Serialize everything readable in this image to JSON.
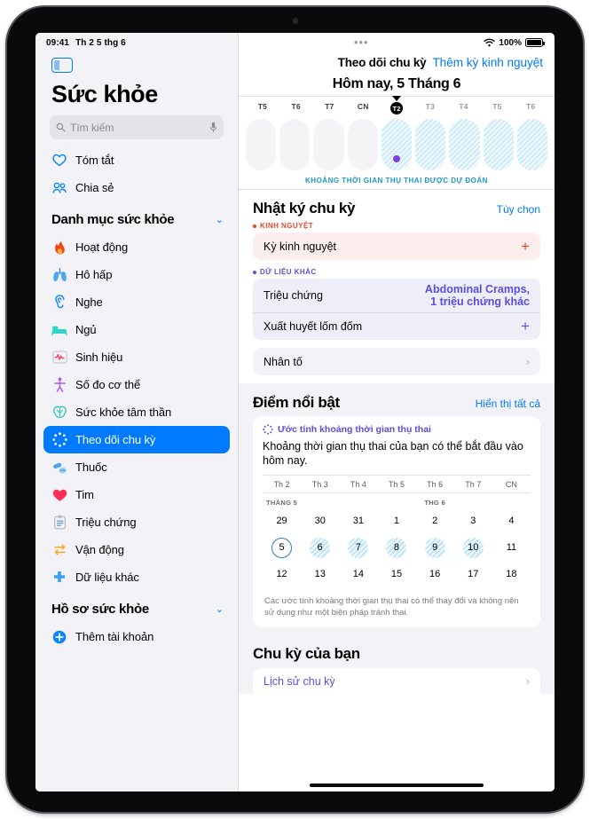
{
  "status": {
    "time": "09:41",
    "date": "Th 2 5 thg 6",
    "battery_pct": "100%",
    "wifi_icon": "wifi-icon"
  },
  "sidebar": {
    "app_title": "Sức khỏe",
    "search": {
      "placeholder": "Tìm kiếm",
      "search_icon": "search-icon",
      "mic_icon": "microphone-icon"
    },
    "toggle_icon": "sidebar-toggle-icon",
    "top_items": [
      {
        "label": "Tóm tắt",
        "icon": "heart-outline-icon"
      },
      {
        "label": "Chia sẻ",
        "icon": "people-icon"
      }
    ],
    "category_header": {
      "label": "Danh mục sức khỏe",
      "chevron": "chevron-down-icon"
    },
    "categories": [
      {
        "label": "Hoạt động",
        "icon": "flame-icon",
        "selected": false
      },
      {
        "label": "Hô hấp",
        "icon": "lungs-icon",
        "selected": false
      },
      {
        "label": "Nghe",
        "icon": "ear-icon",
        "selected": false
      },
      {
        "label": "Ngủ",
        "icon": "bed-icon",
        "selected": false
      },
      {
        "label": "Sinh hiệu",
        "icon": "vitals-icon",
        "selected": false
      },
      {
        "label": "Số đo cơ thể",
        "icon": "body-icon",
        "selected": false
      },
      {
        "label": "Sức khỏe tâm thần",
        "icon": "brain-icon",
        "selected": false
      },
      {
        "label": "Theo dõi chu kỳ",
        "icon": "cycle-icon",
        "selected": true
      },
      {
        "label": "Thuốc",
        "icon": "pills-icon",
        "selected": false
      },
      {
        "label": "Tim",
        "icon": "heart-filled-icon",
        "selected": false
      },
      {
        "label": "Triệu chứng",
        "icon": "clipboard-icon",
        "selected": false
      },
      {
        "label": "Vận động",
        "icon": "mobility-icon",
        "selected": false
      },
      {
        "label": "Dữ liệu khác",
        "icon": "plus-cross-icon",
        "selected": false
      }
    ],
    "profile_header": {
      "label": "Hồ sơ sức khỏe",
      "chevron": "chevron-down-icon"
    },
    "profile_items": [
      {
        "label": "Thêm tài khoản",
        "icon": "plus-circle-icon"
      }
    ]
  },
  "main": {
    "multitask_icon": "multitask-dots-icon",
    "nav_title": "Theo dõi chu kỳ",
    "nav_action": "Thêm kỳ kinh nguyệt",
    "today_title": "Hôm nay, 5 Tháng 6",
    "week_strip": {
      "days": [
        {
          "label": "T5",
          "state": "past",
          "fertile": false,
          "today": false
        },
        {
          "label": "T6",
          "state": "past",
          "fertile": false,
          "today": false
        },
        {
          "label": "T7",
          "state": "past",
          "fertile": false,
          "today": false
        },
        {
          "label": "CN",
          "state": "past",
          "fertile": false,
          "today": false
        },
        {
          "label": "T2",
          "state": "today",
          "fertile": true,
          "today": true
        },
        {
          "label": "T3",
          "state": "future",
          "fertile": true,
          "today": false
        },
        {
          "label": "T4",
          "state": "future",
          "fertile": true,
          "today": false
        },
        {
          "label": "T5",
          "state": "future",
          "fertile": true,
          "today": false
        },
        {
          "label": "T6",
          "state": "future",
          "fertile": true,
          "today": false
        }
      ],
      "caption": "KHOẢNG THỜI GIAN THỤ THAI ĐƯỢC DỰ ĐOÁN"
    },
    "cycle_log": {
      "heading": "Nhật ký chu kỳ",
      "action": "Tùy chọn",
      "period_group_label": "KINH NGUYỆT",
      "period_group_color": "#e8452c",
      "period_rows": [
        {
          "label": "Kỳ kinh nguyệt",
          "value": "+",
          "type": "add"
        }
      ],
      "other_group_label": "DỮ LIỆU KHÁC",
      "other_group_color": "#5d4ddb",
      "other_rows": [
        {
          "label": "Triệu chứng",
          "value": "Abdominal Cramps,\n1 triệu chứng khác",
          "type": "value"
        },
        {
          "label": "Xuất huyết lốm đốm",
          "value": "+",
          "type": "add"
        }
      ],
      "factors_row": {
        "label": "Nhân tố",
        "chevron": "chevron-right-icon"
      }
    },
    "highlights": {
      "heading": "Điểm nổi bật",
      "action": "Hiển thị tất cả",
      "card": {
        "kicker": "Ước tính khoảng thời gian thụ thai",
        "kicker_icon": "cycle-icon",
        "lead": "Khoảng thời gian thụ thai của bạn có thể bắt đầu vào hôm nay.",
        "dow_headers": [
          "Th 2",
          "Th 3",
          "Th 4",
          "Th 5",
          "Th 6",
          "Th 7",
          "CN"
        ],
        "month_markers": [
          {
            "col": 0,
            "label": "THÁNG 5"
          },
          {
            "col": 4,
            "label": "THG 6"
          }
        ],
        "weeks": [
          [
            {
              "n": "29",
              "fertile": false,
              "today": false
            },
            {
              "n": "30",
              "fertile": false,
              "today": false
            },
            {
              "n": "31",
              "fertile": false,
              "today": false
            },
            {
              "n": "1",
              "fertile": false,
              "today": false
            },
            {
              "n": "2",
              "fertile": false,
              "today": false
            },
            {
              "n": "3",
              "fertile": false,
              "today": false
            },
            {
              "n": "4",
              "fertile": false,
              "today": false
            }
          ],
          [
            {
              "n": "5",
              "fertile": false,
              "today": true
            },
            {
              "n": "6",
              "fertile": true,
              "today": false
            },
            {
              "n": "7",
              "fertile": true,
              "today": false
            },
            {
              "n": "8",
              "fertile": true,
              "today": false
            },
            {
              "n": "9",
              "fertile": true,
              "today": false
            },
            {
              "n": "10",
              "fertile": true,
              "today": false
            },
            {
              "n": "11",
              "fertile": false,
              "today": false
            }
          ],
          [
            {
              "n": "12",
              "fertile": false,
              "today": false
            },
            {
              "n": "13",
              "fertile": false,
              "today": false
            },
            {
              "n": "14",
              "fertile": false,
              "today": false
            },
            {
              "n": "15",
              "fertile": false,
              "today": false
            },
            {
              "n": "16",
              "fertile": false,
              "today": false
            },
            {
              "n": "17",
              "fertile": false,
              "today": false
            },
            {
              "n": "18",
              "fertile": false,
              "today": false
            }
          ]
        ],
        "disclaimer": "Các ước tính khoảng thời gian thụ thai có thể thay đổi và không nên sử dụng như một biện pháp tránh thai."
      }
    },
    "your_cycle": {
      "heading": "Chu kỳ của bạn",
      "first_row": "Lịch sử chu kỳ"
    }
  }
}
